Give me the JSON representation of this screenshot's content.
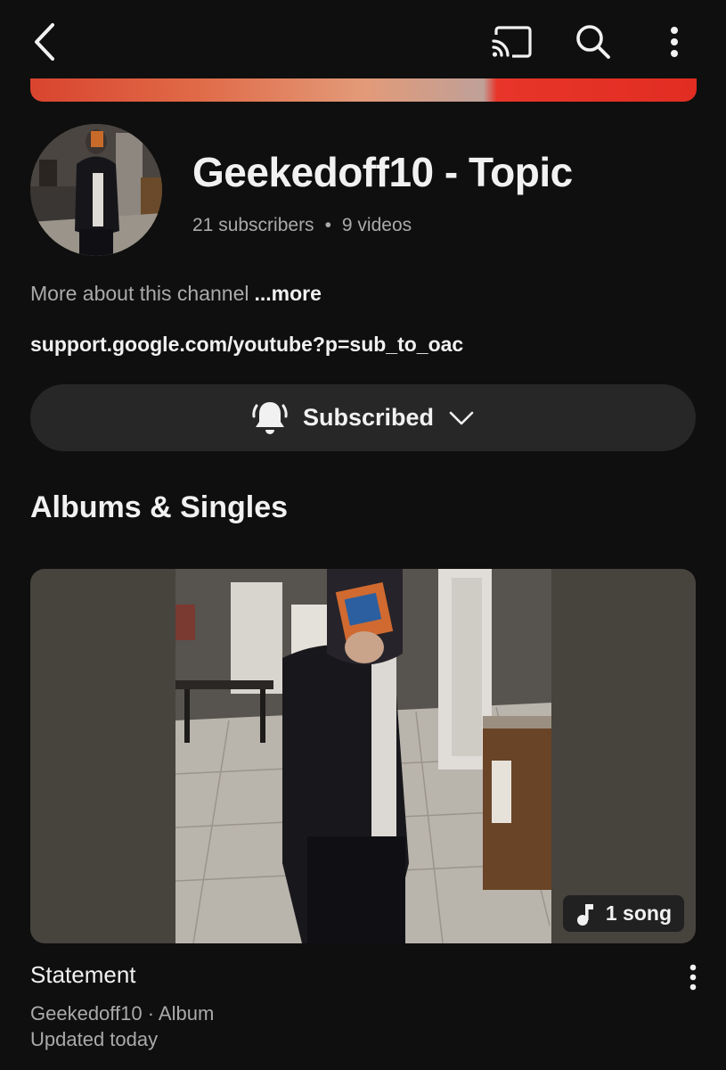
{
  "topbar": {
    "icons": [
      "back-arrow-icon",
      "cast-icon",
      "search-icon",
      "more-vertical-icon"
    ]
  },
  "channel": {
    "name": "Geekedoff10 - Topic",
    "subscribers": "21 subscribers",
    "separator": "•",
    "videos": "9 videos",
    "about": "More about this channel",
    "about_more": "...more",
    "link": "support.google.com/youtube?p=sub_to_oac"
  },
  "subscribe": {
    "label": "Subscribed",
    "icons": [
      "bell-icon",
      "chevron-down-icon"
    ]
  },
  "albums_section": {
    "title": "Albums & Singles",
    "items": [
      {
        "title": "Statement",
        "meta_line1": "Geekedoff10 · Album",
        "meta_line2": "Updated today",
        "badge": "1 song",
        "badge_icon": "music-note-icon"
      }
    ]
  },
  "colors": {
    "background": "#0f0f0f",
    "button_bg": "#272727",
    "text_primary": "#f1f1f1",
    "text_secondary": "#aaaaaa",
    "banner_red": "#e12d22"
  }
}
